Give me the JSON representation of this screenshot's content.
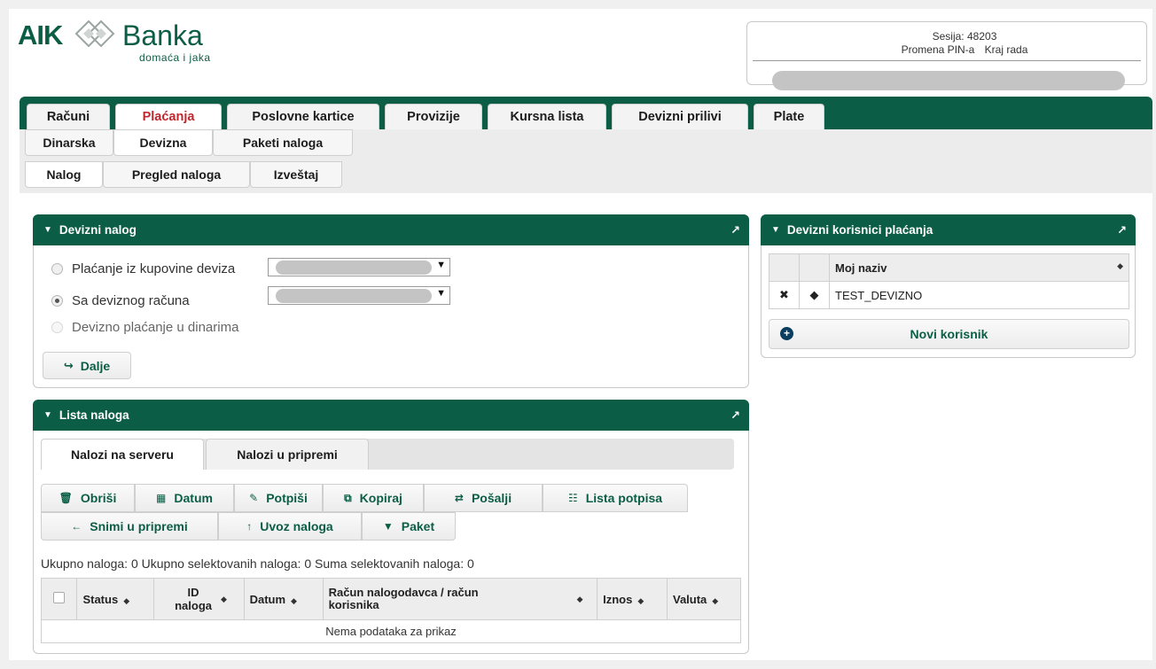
{
  "brand": {
    "name_left": "AIK",
    "name_right": "Banka",
    "tagline": "domaća i jaka"
  },
  "session": {
    "label": "Sesija:",
    "number": "48203",
    "change_pin": "Promena PIN-a",
    "logout": "Kraj rada"
  },
  "main_tabs": [
    "Računi",
    "Plaćanja",
    "Poslovne kartice",
    "Provizije",
    "Kursna lista",
    "Devizni prilivi",
    "Plate"
  ],
  "sub_tabs_1": [
    "Dinarska",
    "Devizna",
    "Paketi naloga"
  ],
  "sub_tabs_2": [
    "Nalog",
    "Pregled naloga",
    "Izveštaj"
  ],
  "devizni_nalog": {
    "title": "Devizni nalog",
    "options": [
      "Plaćanje iz kupovine deviza",
      "Sa deviznog računa",
      "Devizno plaćanje u dinarima"
    ],
    "next_button": "Dalje"
  },
  "lista_naloga": {
    "title": "Lista naloga",
    "tabs": [
      "Nalozi na serveru",
      "Nalozi u pripremi"
    ],
    "toolbar_row1": [
      "Obriši",
      "Datum",
      "Potpiši",
      "Kopiraj",
      "Pošalji",
      "Lista potpisa"
    ],
    "toolbar_row2": [
      "Snimi u pripremi",
      "Uvoz naloga",
      "Paket"
    ],
    "summary": "Ukupno naloga: 0 Ukupno selektovanih naloga: 0 Suma selektovanih naloga: 0",
    "columns": [
      "Status",
      "ID naloga",
      "Datum",
      "Račun nalogodavca / račun korisnika",
      "Iznos",
      "Valuta"
    ],
    "empty_text": "Nema podataka za prikaz"
  },
  "korisnici": {
    "title": "Devizni korisnici plaćanja",
    "column": "Moj naziv",
    "rows": [
      "TEST_DEVIZNO"
    ],
    "new_button": "Novi korisnik"
  }
}
